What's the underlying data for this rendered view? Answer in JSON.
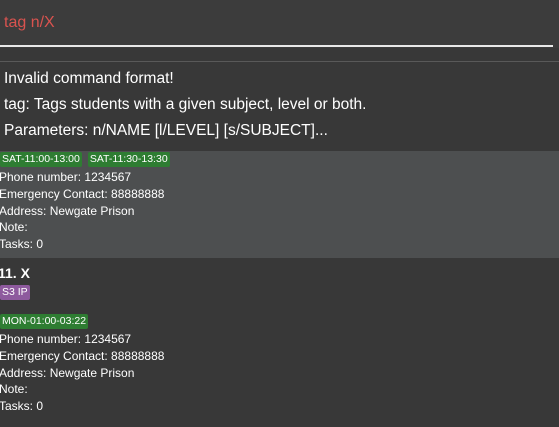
{
  "command_box": {
    "value": "tag n/X"
  },
  "result_display": {
    "lines": [
      "Invalid command format!",
      "tag: Tags students with a given subject, level or both.",
      "Parameters: n/NAME [l/LEVEL] [s/SUBJECT]..."
    ]
  },
  "student_list": {
    "cards": [
      {
        "lesson_tags": [
          "SAT-11:00-13:00",
          "SAT-11:30-13:30"
        ],
        "phone": "Phone number: 1234567",
        "emergency_contact": "Emergency Contact: 88888888",
        "address": "Address: Newgate Prison",
        "note": "Note:",
        "tasks": "Tasks: 0"
      },
      {
        "name": "11. X",
        "subject_tags": [
          "S3 IP"
        ],
        "lesson_tags": [
          "MON-01:00-03:22"
        ],
        "phone": "Phone number: 1234567",
        "emergency_contact": "Emergency Contact: 88888888",
        "address": "Address: Newgate Prison",
        "note": "Note:",
        "tasks": "Tasks: 0"
      }
    ]
  },
  "colors": {
    "background": "#383838",
    "selected_card": "#4d4f50",
    "command_error_text": "#d9534f",
    "lesson_tag": "#2e7d32",
    "subject_tag": "#8e5a9e"
  }
}
